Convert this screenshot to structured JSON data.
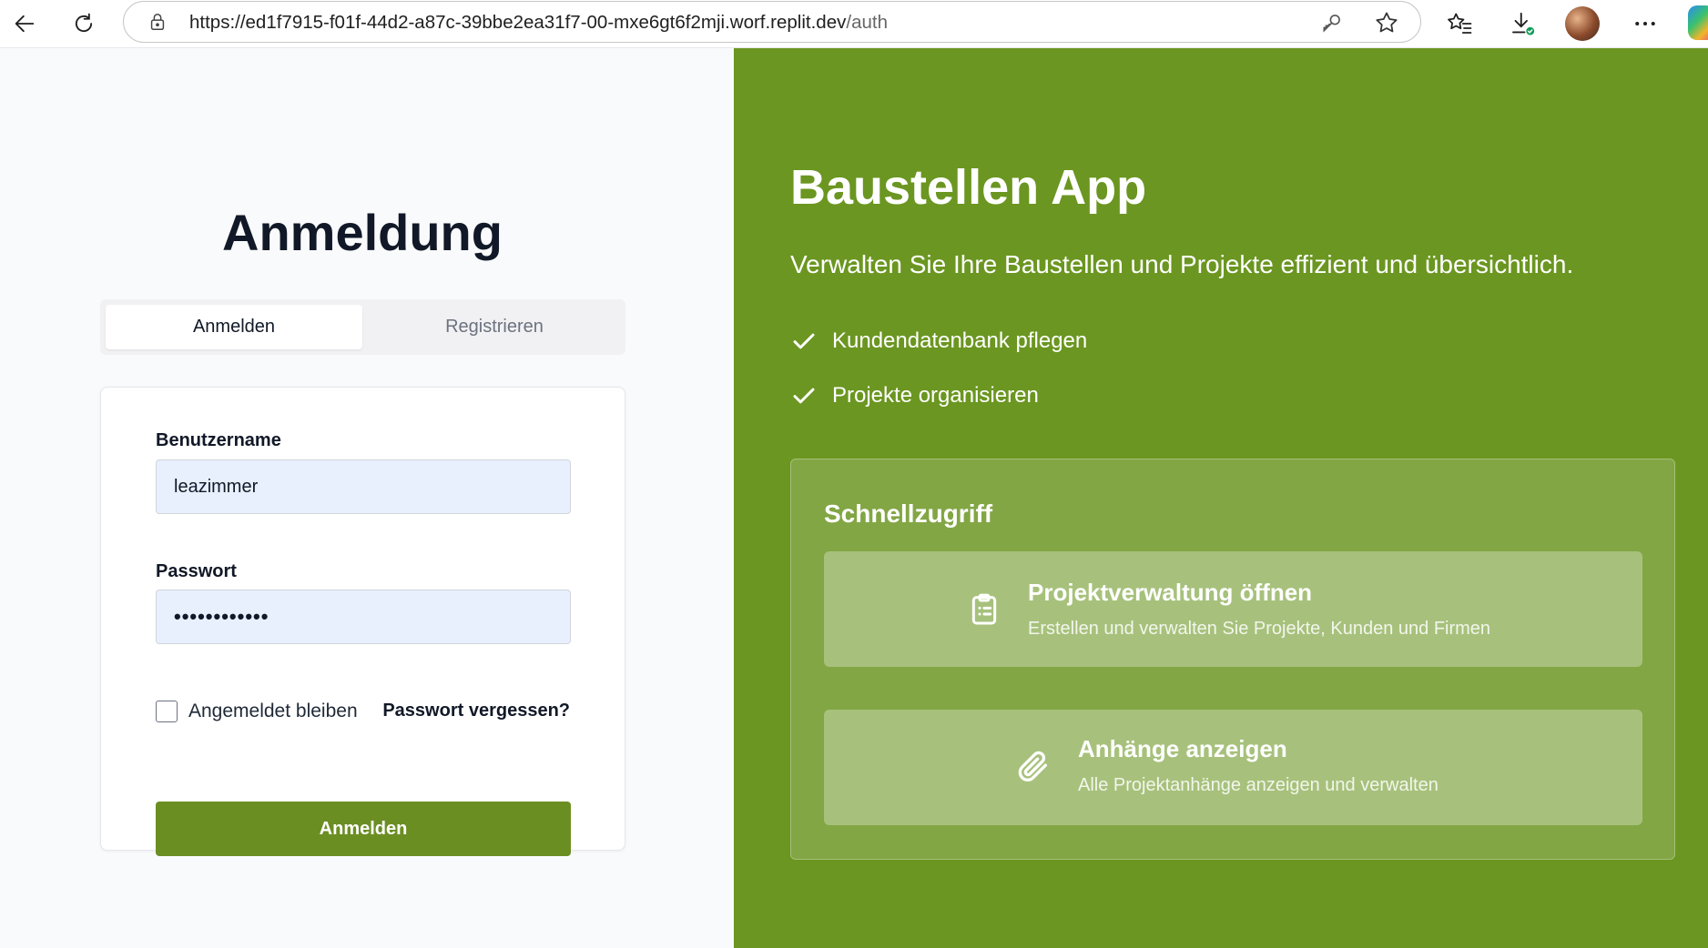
{
  "browser": {
    "url_host": "https://ed1f7915-f01f-44d2-a87c-39bbe2ea31f7-00-mxe6gt6f2mji.worf.replit.dev",
    "url_path": "/auth",
    "icons": [
      "back-icon",
      "refresh-icon",
      "lock-icon",
      "key-icon",
      "star-icon",
      "favorites-icon",
      "downloads-icon",
      "more-icon"
    ]
  },
  "login": {
    "title": "Anmeldung",
    "tabs": [
      {
        "label": "Anmelden",
        "active": true
      },
      {
        "label": "Registrieren",
        "active": false
      }
    ],
    "username_label": "Benutzername",
    "username_value": "leazimmer",
    "password_label": "Passwort",
    "password_value": "••••••••••••",
    "remember_label": "Angemeldet bleiben",
    "remember_checked": false,
    "forgot_label": "Passwort vergessen?",
    "submit_label": "Anmelden"
  },
  "hero": {
    "title": "Baustellen App",
    "subtitle": "Verwalten Sie Ihre Baustellen und Projekte effizient und übersichtlich.",
    "features": [
      "Kundendatenbank pflegen",
      "Projekte organisieren"
    ],
    "quick_title": "Schnellzugriff",
    "quick_items": [
      {
        "icon": "clipboard-icon",
        "title": "Projektverwaltung öffnen",
        "subtitle": "Erstellen und verwalten Sie Projekte, Kunden und Firmen"
      },
      {
        "icon": "paperclip-icon",
        "title": "Anhänge anzeigen",
        "subtitle": "Alle Projektanhänge anzeigen und verwalten"
      }
    ]
  },
  "colors": {
    "brand_green": "#6b9621",
    "button_green": "#6b8e23",
    "input_bg": "#e8f0fe"
  }
}
